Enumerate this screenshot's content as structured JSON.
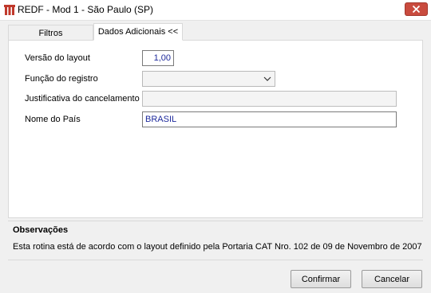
{
  "window": {
    "title": "REDF - Mod 1 - São Paulo (SP)",
    "close_label": "close"
  },
  "tabs": [
    {
      "label": "Filtros",
      "active": false
    },
    {
      "label": "Dados Adicionais <<",
      "active": true
    }
  ],
  "form": {
    "versao_label": "Versão do layout",
    "versao_value": "1,00",
    "funcao_label": "Função do registro",
    "funcao_value": "",
    "justificativa_label": "Justificativa do cancelamento",
    "justificativa_value": "",
    "pais_label": "Nome do País",
    "pais_value": "BRASIL"
  },
  "observacoes": {
    "title": "Observações",
    "text": "Esta rotina está de acordo com o layout definido pela Portaria CAT Nro. 102 de 09 de Novembro de 2007"
  },
  "buttons": {
    "confirmar": "Confirmar",
    "cancelar": "Cancelar"
  },
  "colors": {
    "close_button": "#c94b3e",
    "value_text": "#1e2a9c"
  }
}
